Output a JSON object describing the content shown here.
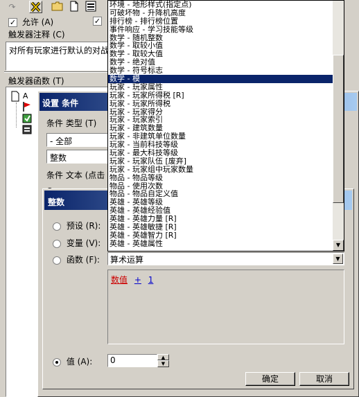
{
  "top": {
    "allow_label": "允许 (A)",
    "allow_checked": true,
    "comment_label": "触发器注释 (C)",
    "comment_text": "对所有玩家进行默认的对战",
    "functions_label": "触发器函数 (T)"
  },
  "tree": {
    "root_label": "A"
  },
  "condition_dialog": {
    "title": "设置 条件",
    "type_label": "条件 类型 (T)",
    "category_value": "- 全部",
    "type_value": "整数",
    "text_label": "条件 文本 (点击"
  },
  "integer_dialog": {
    "title": "整数",
    "preset_label": "预设 (R):",
    "variable_label": "变量 (V):",
    "function_label": "函数 (F):",
    "function_value": "算术运算",
    "expr_part1": "数值",
    "expr_op": "+",
    "expr_part2": "1",
    "value_label": "值 (A):",
    "value_input": "0",
    "ok_label": "确定",
    "cancel_label": "取消"
  },
  "dropdown_list": {
    "items": [
      "环境 - 地形样式(指定点)",
      "可破坏物 - 升降机高度",
      "排行榜 - 排行榜位置",
      "事件响应 - 学习技能等级",
      "数学 - 随机整数",
      "数学 - 取较小值",
      "数学 - 取较大值",
      "数学 - 绝对值",
      "数学 - 符号标志",
      "数学 - 模",
      "玩家 - 玩家属性",
      "玩家 - 玩家所得税 [R]",
      "玩家 - 玩家所得税",
      "玩家 - 玩家得分",
      "玩家 - 玩家索引",
      "玩家 - 建筑数量",
      "玩家 - 非建筑单位数量",
      "玩家 - 当前科技等级",
      "玩家 - 最大科技等级",
      "玩家 - 玩家队伍 [废弃]",
      "玩家 - 玩家组中玩家数量",
      "物品 - 物品等级",
      "物品 - 使用次数",
      "物品 - 物品自定义值",
      "英雄 - 英雄等级",
      "英雄 - 英雄经验值",
      "英雄 - 英雄力量 [R]",
      "英雄 - 英雄敏捷 [R]",
      "英雄 - 英雄智力 [R]",
      "英雄 - 英雄属性"
    ],
    "selected_index": 9
  },
  "colors": {
    "selection": "#0a246a",
    "title_start": "#0a246a",
    "title_end": "#a6caf0",
    "face": "#d4d0c8"
  }
}
